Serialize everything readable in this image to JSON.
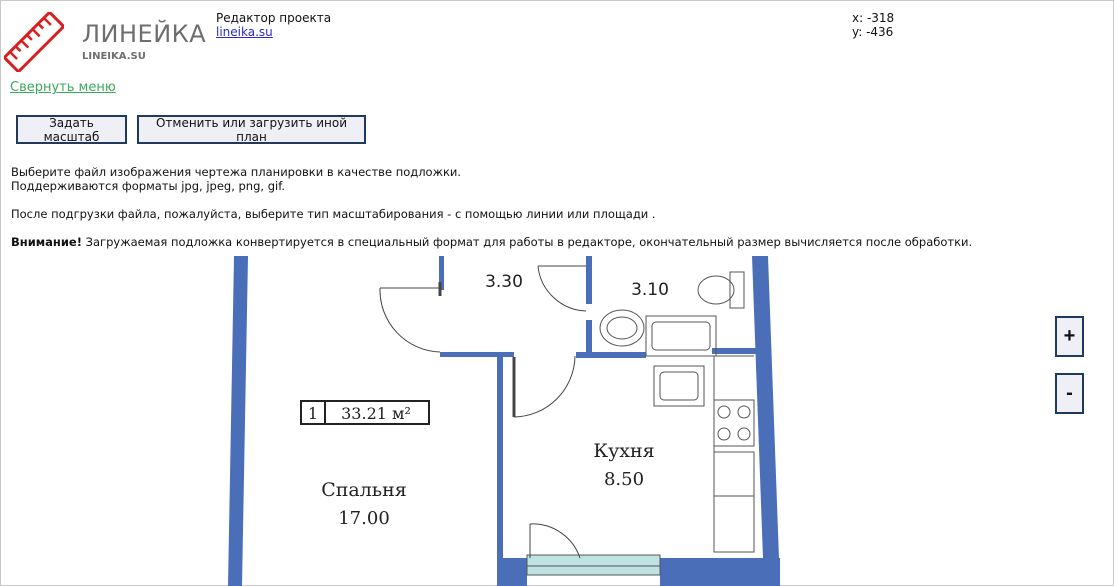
{
  "logo": {
    "name": "ЛИНЕЙКА",
    "sub": "LINEIKA.SU",
    "icon": "ruler-icon",
    "color": "#d81f1f"
  },
  "header": {
    "title": "Редактор проекта",
    "link": "lineika.su"
  },
  "coords": {
    "x": "x: -318",
    "y": "y: -436"
  },
  "menu": {
    "collapse": "Свернуть меню"
  },
  "buttons": {
    "scale": "Задать масштаб",
    "cancel": "Отменить или загрузить иной план"
  },
  "info": {
    "line1": "Выберите файл изображения чертежа планировки в качестве подложки.",
    "line2": "Поддерживаются форматы jpg, jpeg, png, gif.",
    "line3": "После подгрузки файла, пожалуйста, выберите тип масштабирования - с помощью линии или площади .",
    "warning_label": "Внимание!",
    "warning_text": " Загружаемая подложка конвертируется в специальный формат для работы в редакторе, окончательный размер вычисляется после обработки."
  },
  "plan": {
    "wall_color": "#4a6fb8",
    "balcony_color": "#bfe3e3",
    "room_330": "3.30",
    "room_310": "3.10",
    "kitchen_name": "Кухня",
    "kitchen_area": "8.50",
    "bedroom_name": "Спальня",
    "bedroom_area": "17.00",
    "badge_num": "1",
    "badge_area": "33.21 м²"
  },
  "zoom": {
    "in": "+",
    "out": "-"
  }
}
